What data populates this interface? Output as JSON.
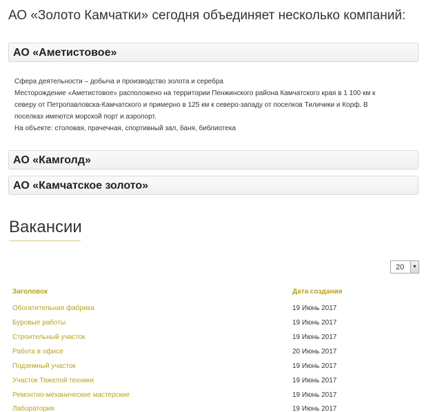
{
  "intro": {
    "heading": "АО «Золото Камчатки» сегодня объединяет несколько компаний:"
  },
  "companies": [
    {
      "name": "АО «Аметистовое»",
      "expanded": true,
      "lines": [
        "Сфера деятельности – добыча и производство золота и серебра",
        "Месторождение «Аметистовое» расположено на территории Пенжинского района Камчатского края в 1 100 км к",
        "северу от Петропавловска-Камчатского и примерно в 125 км к северо-западу от поселков Тиличики и Корф. В",
        "поселках имеются морской порт и аэропорт.",
        "На объекте: столовая, прачечная, спортивный зал, баня, библиотека"
      ]
    },
    {
      "name": "АО «Камголд»",
      "expanded": false
    },
    {
      "name": "АО «Камчатское золото»",
      "expanded": false
    }
  ],
  "vacancies": {
    "title": "Вакансии",
    "per_page": "20",
    "columns": {
      "title": "Заголовок",
      "created": "Дата создания"
    },
    "rows": [
      {
        "title": "Обогатительная фабрика",
        "date": "19 Июнь 2017"
      },
      {
        "title": "Буровые работы",
        "date": "19 Июнь 2017"
      },
      {
        "title": "Строительный участок",
        "date": "19 Июнь 2017"
      },
      {
        "title": "Работа в офисе",
        "date": "20 Июнь 2017"
      },
      {
        "title": "Подземный участок",
        "date": "19 Июнь 2017"
      },
      {
        "title": "Участок Тяжелой техники",
        "date": "19 Июнь 2017"
      },
      {
        "title": "Ремонтно-механические мастерские",
        "date": "19 Июнь 2017"
      },
      {
        "title": "Лаборатория",
        "date": "19 Июнь 2017"
      }
    ]
  },
  "colors": {
    "accent": "#b8a318",
    "text": "#333333",
    "panel_border": "#d8d8d8"
  }
}
